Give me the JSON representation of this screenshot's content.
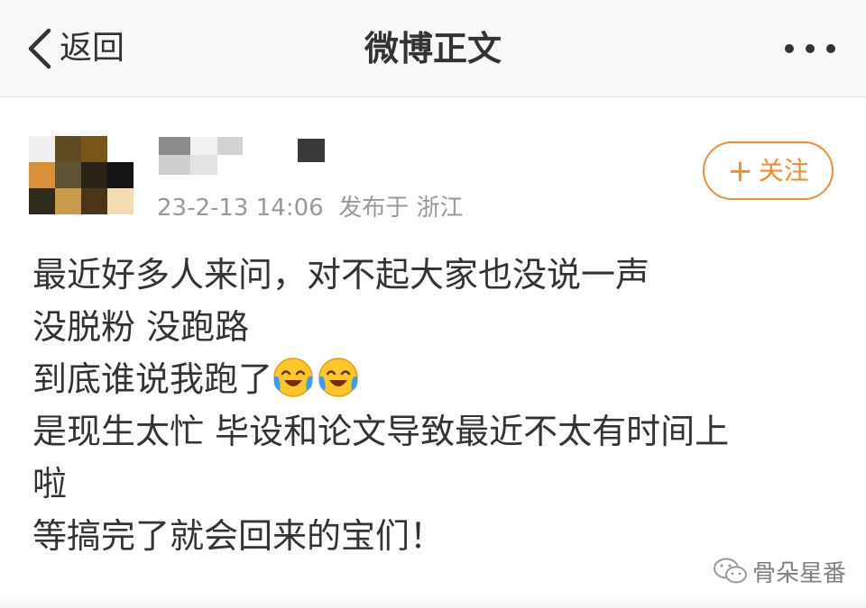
{
  "navbar": {
    "back_label": "返回",
    "title": "微博正文",
    "more_icon": "more-dots-icon"
  },
  "author": {
    "avatar": "pixelated-avatar",
    "username": "pixelated-username",
    "timestamp": "23-2-13 14:06",
    "location_prefix": "发布于",
    "location": "浙江",
    "follow_button": {
      "icon": "plus-icon",
      "icon_glyph": "+",
      "label": "关注"
    }
  },
  "post": {
    "lines": [
      "最近好多人来问，对不起大家也没说一声",
      "没脱粉 没跑路",
      "到底谁说我跑了",
      "是现生太忙 毕设和论文导致最近不太有时间上",
      "啦",
      "等搞完了就会回来的宝们！"
    ],
    "emoji": "laughing-crying-emoji"
  },
  "watermark": {
    "icon": "wechat-icon",
    "text": "骨朵星番"
  },
  "colors": {
    "accent": "#f48c2b",
    "text": "#333333",
    "meta": "#999999",
    "navbar_bg": "#f8f8f8"
  }
}
